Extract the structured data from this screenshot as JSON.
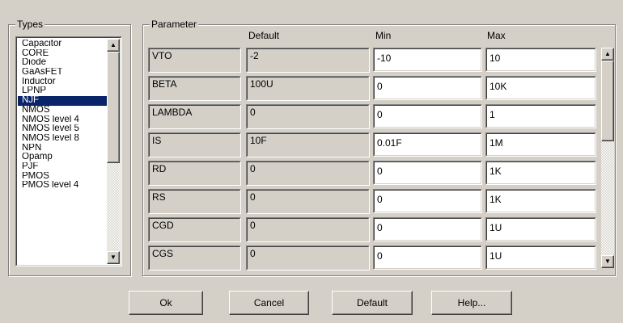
{
  "types_group": {
    "title": "Types",
    "items": [
      "Capacitor",
      "CORE",
      "Diode",
      "GaAsFET",
      "Inductor",
      "LPNP",
      "NJF",
      "NMOS",
      "NMOS level 4",
      "NMOS level 5",
      "NMOS level 8",
      "NPN",
      "Opamp",
      "PJF",
      "PMOS",
      "PMOS level 4"
    ],
    "selected": "NJF"
  },
  "parameter_group": {
    "title": "Parameter",
    "headers": {
      "default": "Default",
      "min": "Min",
      "max": "Max"
    },
    "rows": [
      {
        "name": "VTO",
        "default": "-2",
        "min": "-10",
        "max": "10"
      },
      {
        "name": "BETA",
        "default": "100U",
        "min": "0",
        "max": "10K"
      },
      {
        "name": "LAMBDA",
        "default": "0",
        "min": "0",
        "max": "1"
      },
      {
        "name": "IS",
        "default": "10F",
        "min": "0.01F",
        "max": "1M"
      },
      {
        "name": "RD",
        "default": "0",
        "min": "0",
        "max": "1K"
      },
      {
        "name": "RS",
        "default": "0",
        "min": "0",
        "max": "1K"
      },
      {
        "name": "CGD",
        "default": "0",
        "min": "0",
        "max": "1U"
      },
      {
        "name": "CGS",
        "default": "0",
        "min": "0",
        "max": "1U"
      }
    ]
  },
  "buttons": {
    "ok": "Ok",
    "cancel": "Cancel",
    "default": "Default",
    "help": "Help..."
  },
  "icons": {
    "scroll_up": "up-arrow-icon",
    "scroll_down": "down-arrow-icon"
  },
  "colors": {
    "face": "#d4d0c8",
    "selection": "#0a246a"
  }
}
